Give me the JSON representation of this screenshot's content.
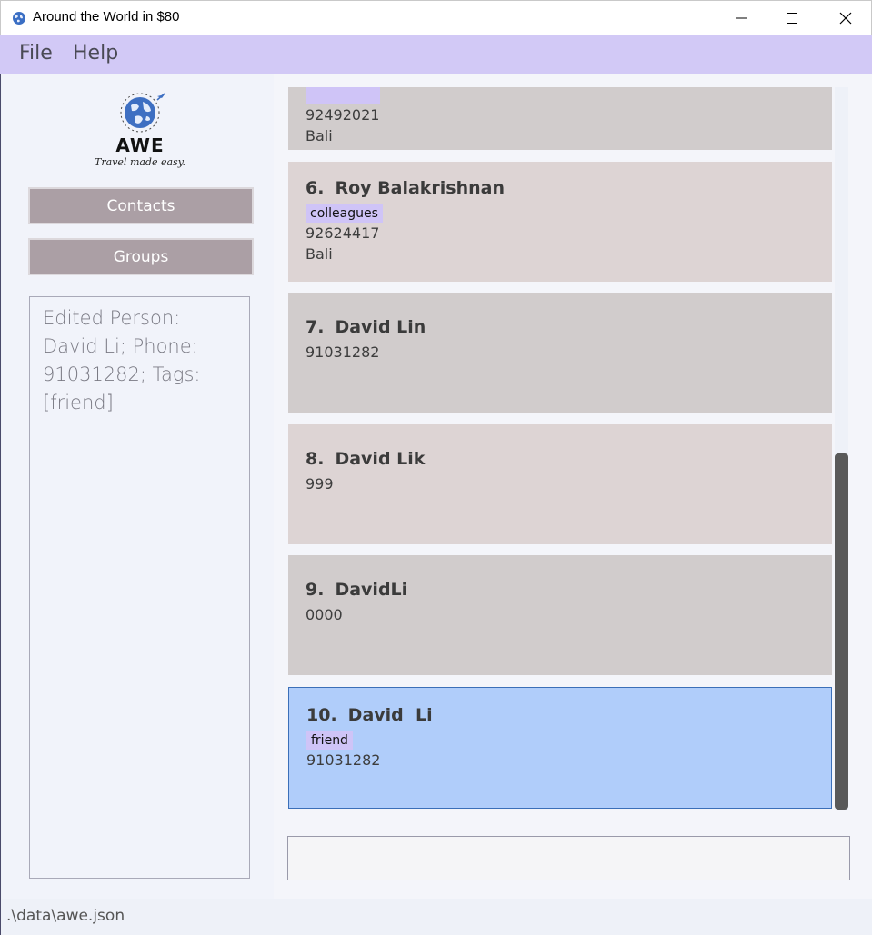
{
  "window": {
    "title": "Around the World in $80",
    "icon": "globe-icon"
  },
  "menu": {
    "file": "File",
    "help": "Help"
  },
  "logo": {
    "name": "AWE",
    "tagline": "Travel made easy."
  },
  "nav": {
    "contacts": "Contacts",
    "groups": "Groups"
  },
  "result": {
    "text": "Edited Person: David Li; Phone: 91031282; Tags: [friend]"
  },
  "persons": [
    {
      "index": "",
      "name": "",
      "tag": "",
      "phone": "92492021",
      "address": "Bali"
    },
    {
      "index": "6.",
      "name": "Roy Balakrishnan",
      "tag": "colleagues",
      "phone": "92624417",
      "address": "Bali"
    },
    {
      "index": "7.",
      "name": "David Lin",
      "tag": "",
      "phone": "91031282",
      "address": ""
    },
    {
      "index": "8.",
      "name": "David Lik",
      "tag": "",
      "phone": "999",
      "address": ""
    },
    {
      "index": "9.",
      "name": "DavidLi",
      "tag": "",
      "phone": "0000",
      "address": ""
    },
    {
      "index": "10.",
      "name": "David  Li",
      "tag": "friend",
      "phone": "91031282",
      "address": ""
    }
  ],
  "command": {
    "value": ""
  },
  "status": {
    "path": ".\\data\\awe.json"
  },
  "colors": {
    "menubar": "#d2c9f6",
    "tag": "#cfc4f7",
    "selected": "#b0cdfa",
    "nav_button": "#ab9fa5"
  }
}
